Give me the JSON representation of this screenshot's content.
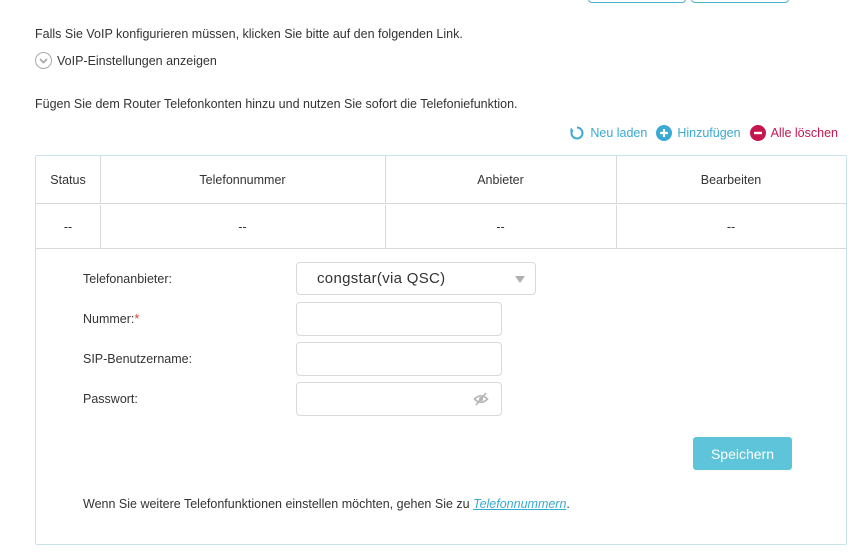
{
  "intro": {
    "voip_hint": "Falls Sie VoIP konfigurieren müssen, klicken Sie bitte auf den folgenden Link.",
    "voip_link": "VoIP-Einstellungen anzeigen",
    "accounts_hint": "Fügen Sie dem Router Telefonkonten hinzu und nutzen Sie sofort die Telefoniefunktion."
  },
  "actions": {
    "reload": "Neu laden",
    "add": "Hinzufügen",
    "clear_all": "Alle löschen"
  },
  "table": {
    "headers": [
      "Status",
      "Telefonnummer",
      "Anbieter",
      "Bearbeiten"
    ],
    "rows": [
      [
        "--",
        "--",
        "--",
        "--"
      ]
    ]
  },
  "form": {
    "provider_label": "Telefonanbieter:",
    "provider_value": "congstar(via QSC)",
    "number_label": "Nummer:",
    "required_mark": "*",
    "sip_label": "SIP-Benutzername:",
    "password_label": "Passwort:",
    "save_label": "Speichern",
    "footer_text": "Wenn Sie weitere Telefonfunktionen einstellen möchten, gehen Sie zu ",
    "footer_link": "Telefonnummern",
    "footer_end": "."
  },
  "colors": {
    "accent": "#3aa9d3",
    "danger": "#c4174e",
    "button": "#5ec4da"
  }
}
